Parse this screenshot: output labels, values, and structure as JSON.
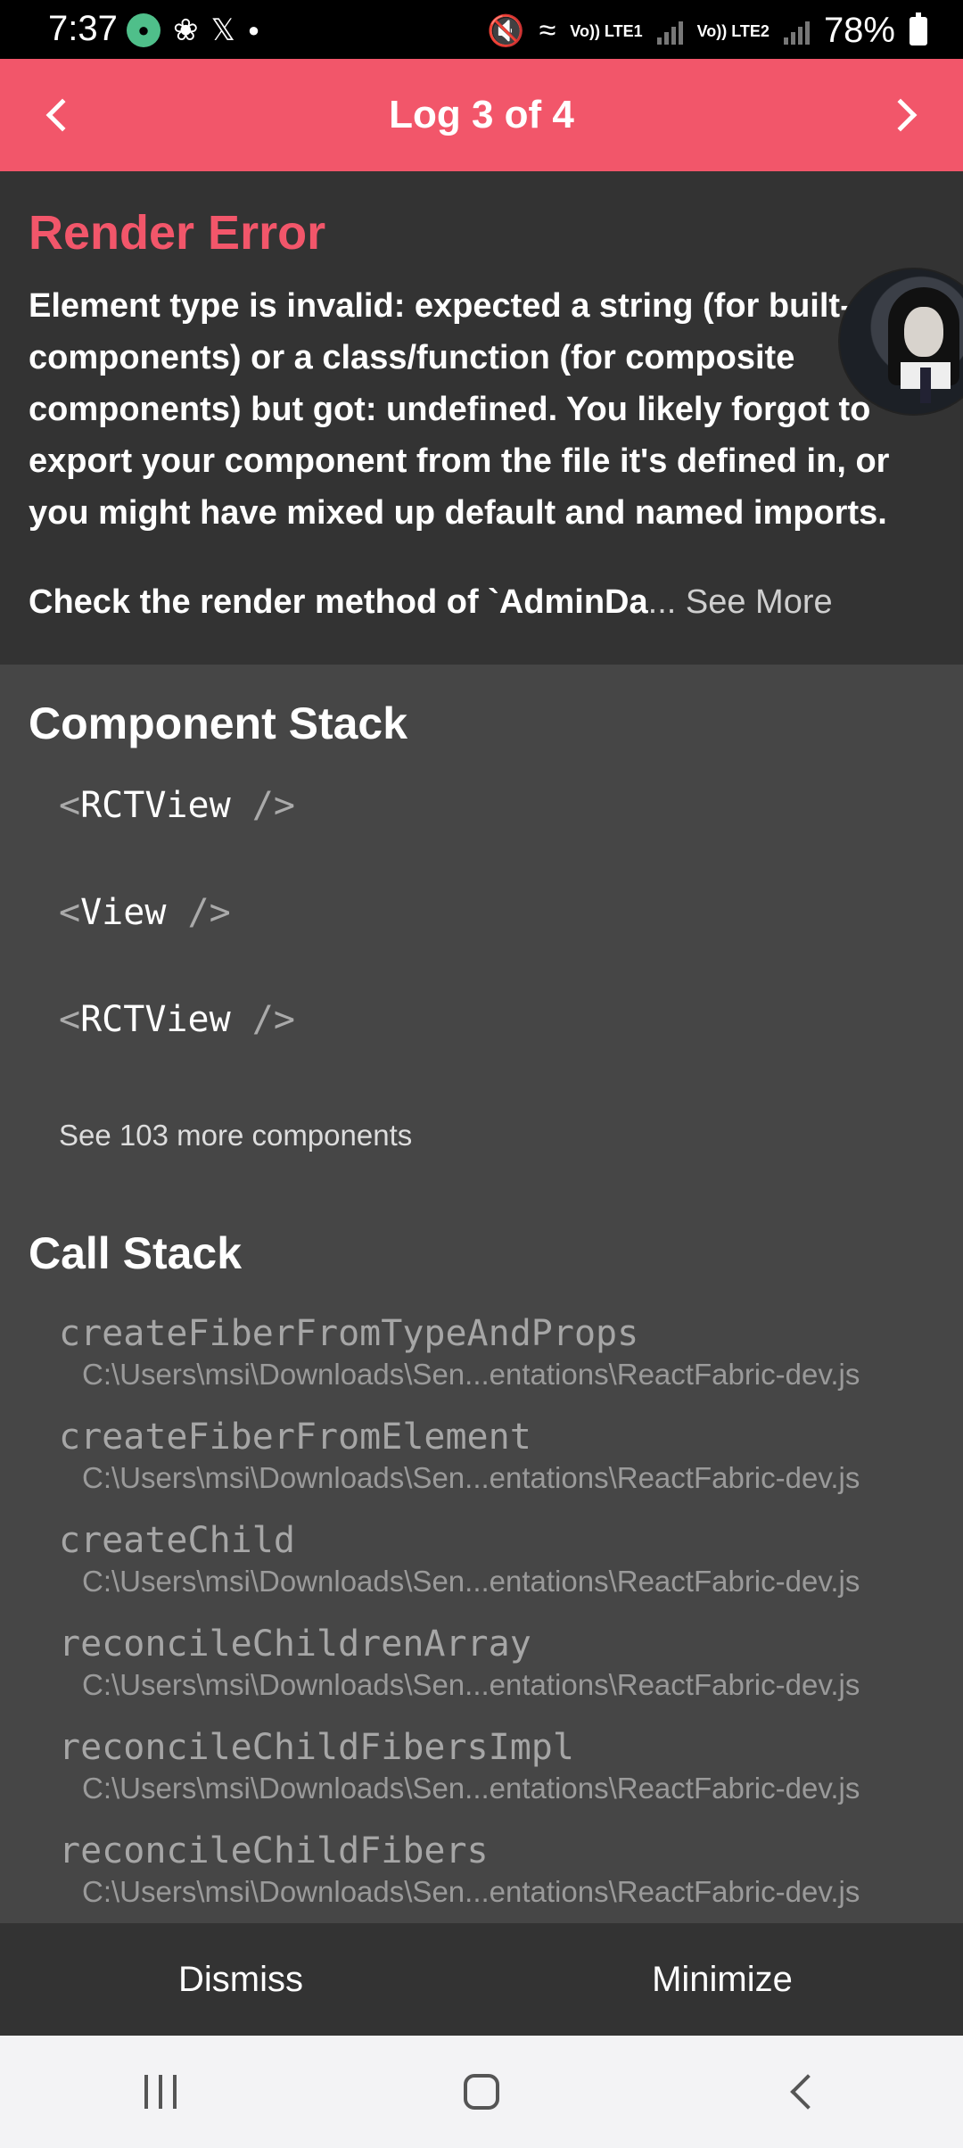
{
  "status_bar": {
    "time": "7:37",
    "network_1": "Vo)) LTE1",
    "network_2": "Vo)) LTE2",
    "battery": "78%"
  },
  "header": {
    "title": "Log 3 of 4",
    "prev_icon": "chevron-left-icon",
    "next_icon": "chevron-right-icon"
  },
  "error": {
    "title": "Render Error",
    "message_lines": [
      "Element type is invalid: expected a string (for built-",
      "components) or a class/function (for composite",
      "components) but got: undefined. You likely forgot to",
      "export your component from the file it's defined in, or",
      "you might have mixed up default and named imports."
    ],
    "check_text": "Check the render method of `AdminDa",
    "see_more": "... See More"
  },
  "component_stack": {
    "heading": "Component Stack",
    "items": [
      {
        "open": "<",
        "name": "RCTView",
        "close": " />"
      },
      {
        "open": "<",
        "name": "View",
        "close": " />"
      },
      {
        "open": "<",
        "name": "RCTView",
        "close": " />"
      }
    ],
    "see_more": "See 103 more components"
  },
  "call_stack": {
    "heading": "Call Stack",
    "frames": [
      {
        "name": "createFiberFromTypeAndProps",
        "file": "C:\\Users\\msi\\Downloads\\Sen...entations\\ReactFabric-dev.js"
      },
      {
        "name": "createFiberFromElement",
        "file": "C:\\Users\\msi\\Downloads\\Sen...entations\\ReactFabric-dev.js"
      },
      {
        "name": "createChild",
        "file": "C:\\Users\\msi\\Downloads\\Sen...entations\\ReactFabric-dev.js"
      },
      {
        "name": "reconcileChildrenArray",
        "file": "C:\\Users\\msi\\Downloads\\Sen...entations\\ReactFabric-dev.js"
      },
      {
        "name": "reconcileChildFibersImpl",
        "file": "C:\\Users\\msi\\Downloads\\Sen...entations\\ReactFabric-dev.js"
      },
      {
        "name": "reconcileChildFibers",
        "file": "C:\\Users\\msi\\Downloads\\Sen...entations\\ReactFabric-dev.js"
      }
    ]
  },
  "footer": {
    "dismiss": "Dismiss",
    "minimize": "Minimize"
  },
  "colors": {
    "accent": "#f2566a",
    "error_bg": "#333333",
    "body_bg": "#464646"
  }
}
